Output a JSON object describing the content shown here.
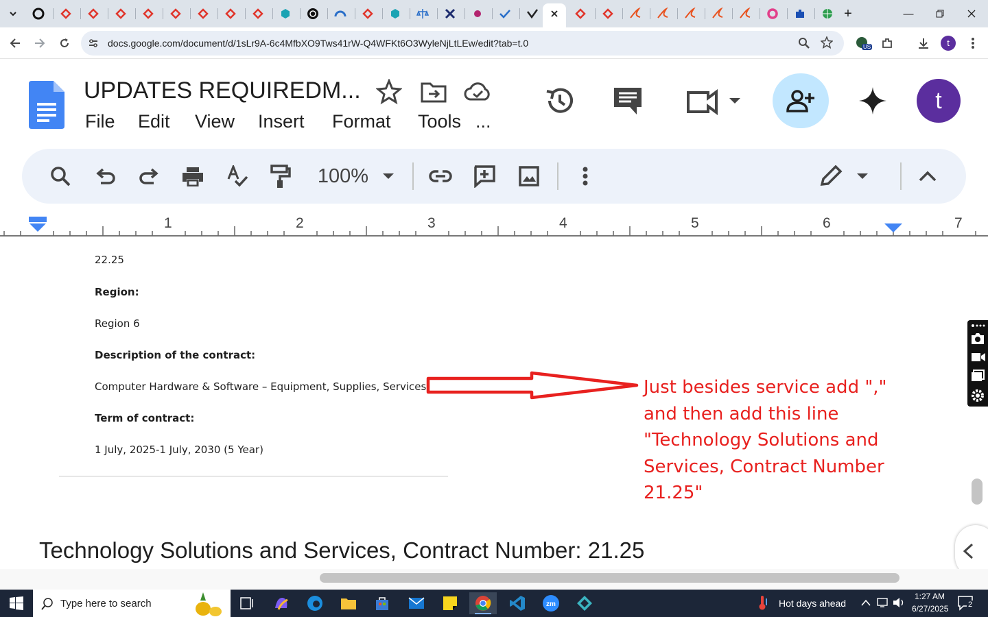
{
  "browser": {
    "url": "docs.google.com/document/d/1sLr9A-6c4MfbXO9Tws41rW-Q4WFKt6O3WyleNjLtLEw/edit?tab=t.0",
    "profile_initial": "t",
    "ext_badge": "US"
  },
  "docs": {
    "title": "UPDATES REQUIREDM...",
    "menu": [
      "File",
      "Edit",
      "View",
      "Insert",
      "Format",
      "Tools",
      "..."
    ],
    "avatar_initial": "t",
    "zoom": "100%"
  },
  "ruler": {
    "numbers": [
      "1",
      "2",
      "3",
      "4",
      "5",
      "6",
      "7"
    ]
  },
  "document": {
    "lines": [
      {
        "text": "22.25",
        "bold": false
      },
      {
        "text": "Region:",
        "bold": true
      },
      {
        "text": "Region 6",
        "bold": false
      },
      {
        "text": "Description of the contract:",
        "bold": true
      },
      {
        "text": "Computer Hardware & Software – Equipment, Supplies, Services",
        "bold": false
      },
      {
        "text": "Term of contract:",
        "bold": true
      },
      {
        "text": "1 July, 2025-1 July, 2030 (5 Year)",
        "bold": false
      }
    ],
    "annotation": "Just besides service add \",\" and then add this line \"Technology Solutions and Services, Contract Number 21.25\"",
    "large_line": "Technology Solutions and Services, Contract Number: 21.25"
  },
  "taskbar": {
    "search_placeholder": "Type here to search",
    "weather": "Hot days ahead",
    "time": "1:27 AM",
    "date": "6/27/2025",
    "notification_count": "2"
  },
  "colors": {
    "annotation": "#e8211f",
    "docs_blue": "#4285f4",
    "avatar": "#5b2e9e",
    "share_bg": "#c2e7ff"
  }
}
